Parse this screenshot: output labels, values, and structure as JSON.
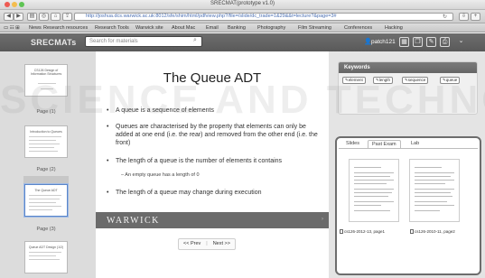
{
  "window": {
    "title": "SRECMAT(prototype v1.0)"
  },
  "browser": {
    "url": "http://joshua.dcs.warwick.ac.uk:8012/sfe/shim/html/pdfview.php?/file=/slide/dc_trade=1&29&&t=lecture?&page=3#",
    "bookmarks": [
      "News",
      "Research resources",
      "Research Tools",
      "Warwick site",
      "About Mac",
      "Email",
      "Banking",
      "Photography",
      "Film Streaming",
      "Conferences",
      "Hacking"
    ]
  },
  "header": {
    "brand": "SRECMATs",
    "search_placeholder": "Search for materials",
    "username": "patch121"
  },
  "thumbnails": [
    {
      "title": "CS126 Design of Information Structures",
      "page_label": "Page (1)"
    },
    {
      "title": "Introduction to Queues",
      "page_label": "Page (2)"
    },
    {
      "title": "The Queue ADT",
      "page_label": "Page (3)"
    },
    {
      "title": "Queue ADT Design (1/2)",
      "page_label": ""
    }
  ],
  "slide": {
    "title": "The Queue ADT",
    "bullets": [
      "A queue is a sequence of elements",
      "Queues are characterised by the property that elements can only be added at one end (i.e. the rear) and removed from the other end (i.e. the front)",
      "The length of a queue is the number of elements it contains",
      "The length of a queue may change during execution"
    ],
    "sub_bullet": "An empty queue has a length of 0",
    "footer_logo": "WARWICK"
  },
  "pager": {
    "prev": "<< Prev",
    "next": "Next >>"
  },
  "keywords": {
    "heading": "Keywords",
    "tags": [
      "element",
      "length",
      "sequence",
      "queue"
    ]
  },
  "resources": {
    "tabs": [
      "Slides",
      "Past Exam",
      "Lab"
    ],
    "active_tab": "Past Exam",
    "documents": [
      "cs126-2012-13, page1",
      "cs126-2010-11, page2"
    ]
  },
  "watermark": "SCIENCE AND TECHNOLOGY PUBLICATIONS"
}
